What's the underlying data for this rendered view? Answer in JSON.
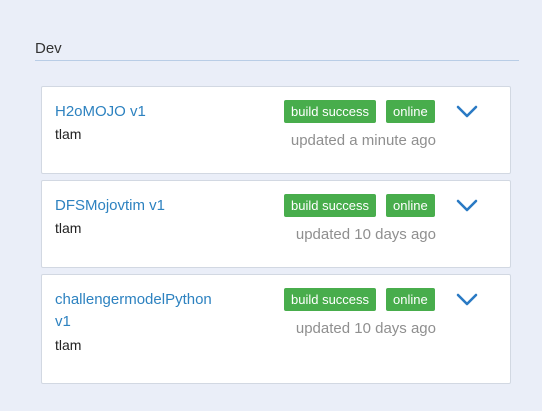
{
  "section": {
    "title": "Dev"
  },
  "cards": [
    {
      "name": "H2oMOJO v1",
      "owner": "tlam",
      "build_status": "build success",
      "online_status": "online",
      "updated": "updated a minute ago"
    },
    {
      "name": "DFSMojovtim v1",
      "owner": "tlam",
      "build_status": "build success",
      "online_status": "online",
      "updated": "updated 10 days ago"
    },
    {
      "name": "challengermodelPython v1",
      "owner": "tlam",
      "build_status": "build success",
      "online_status": "online",
      "updated": "updated 10 days ago"
    }
  ],
  "icons": {
    "expand": "chevron-down-icon"
  },
  "colors": {
    "link": "#2d82c0",
    "badge": "#48ad4c",
    "chevron": "#2a7ac4",
    "background": "#eaeef8"
  }
}
